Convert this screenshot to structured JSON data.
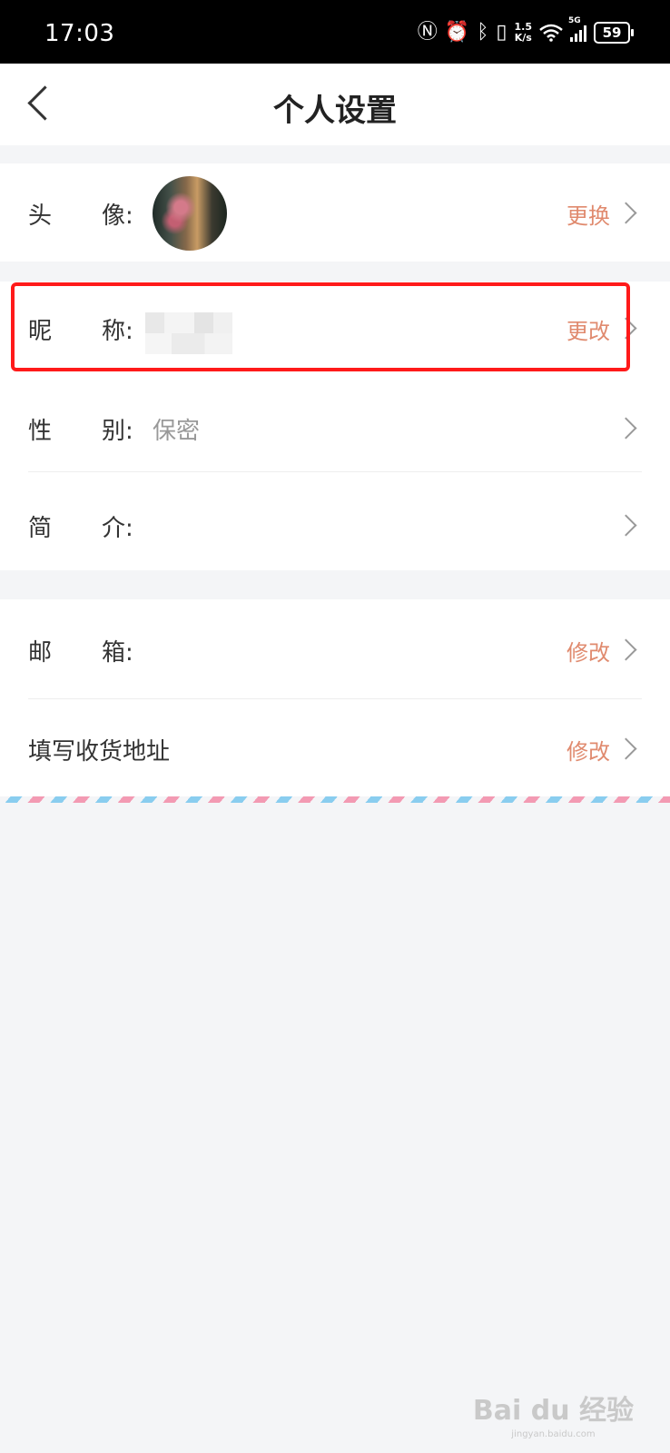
{
  "status_bar": {
    "time": "17:03",
    "net_speed_value": "1.5",
    "net_speed_unit": "K/s",
    "network": "5G",
    "battery": "59"
  },
  "header": {
    "title": "个人设置"
  },
  "profile": {
    "avatar": {
      "label1": "头",
      "label2": "像:",
      "action": "更换"
    },
    "nickname": {
      "label1": "昵",
      "label2": "称:",
      "action": "更改"
    },
    "gender": {
      "label1": "性",
      "label2": "别:",
      "value": "保密"
    },
    "bio": {
      "label1": "简",
      "label2": "介:"
    }
  },
  "contact": {
    "email": {
      "label1": "邮",
      "label2": "箱:",
      "action": "修改"
    },
    "address": {
      "label": "填写收货地址",
      "action": "修改"
    }
  },
  "watermark": {
    "text": "Bai du 经验",
    "sub": "jingyan.baidu.com"
  },
  "colors": {
    "accent": "#e08a6e",
    "highlight": "#ff1a1a",
    "background": "#f4f5f7"
  }
}
